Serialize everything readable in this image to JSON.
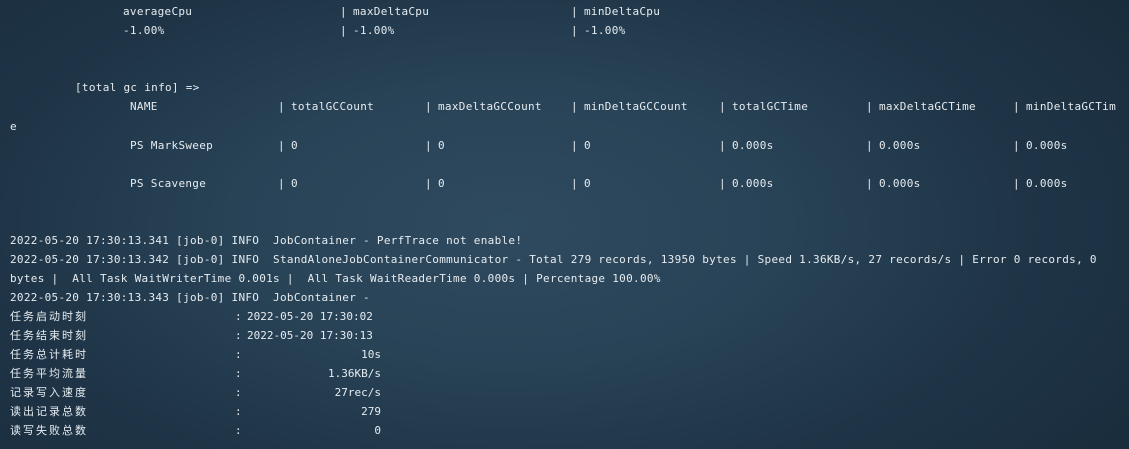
{
  "cpu": {
    "headers": [
      "averageCpu",
      "maxDeltaCpu",
      "minDeltaCpu"
    ],
    "values": [
      "-1.00%",
      "-1.00%",
      "-1.00%"
    ]
  },
  "gc": {
    "title": "[total gc info] =>",
    "headers": [
      "NAME",
      "totalGCCount",
      "maxDeltaGCCount",
      "minDeltaGCCount",
      "totalGCTime",
      "maxDeltaGCTime",
      "minDeltaGCTim"
    ],
    "header_wrap": "e",
    "rows": [
      [
        "PS MarkSweep",
        "0",
        "0",
        "0",
        "0.000s",
        "0.000s",
        "0.000s"
      ],
      [
        "PS Scavenge",
        "0",
        "0",
        "0",
        "0.000s",
        "0.000s",
        "0.000s"
      ]
    ]
  },
  "logs": [
    "2022-05-20 17:30:13.341 [job-0] INFO  JobContainer - PerfTrace not enable!",
    "2022-05-20 17:30:13.342 [job-0] INFO  StandAloneJobContainerCommunicator - Total 279 records, 13950 bytes | Speed 1.36KB/s, 27 records/s | Error 0 records, 0",
    "bytes |  All Task WaitWriterTime 0.001s |  All Task WaitReaderTime 0.000s | Percentage 100.00%",
    "2022-05-20 17:30:13.343 [job-0] INFO  JobContainer -"
  ],
  "summary": [
    {
      "label": "任务启动时刻",
      "value": "2022-05-20 17:30:02"
    },
    {
      "label": "任务结束时刻",
      "value": "2022-05-20 17:30:13"
    },
    {
      "label": "任务总计耗时",
      "value": "10s"
    },
    {
      "label": "任务平均流量",
      "value": "1.36KB/s"
    },
    {
      "label": "记录写入速度",
      "value": "27rec/s"
    },
    {
      "label": "读出记录总数",
      "value": "279"
    },
    {
      "label": "读写失败总数",
      "value": "0"
    }
  ]
}
